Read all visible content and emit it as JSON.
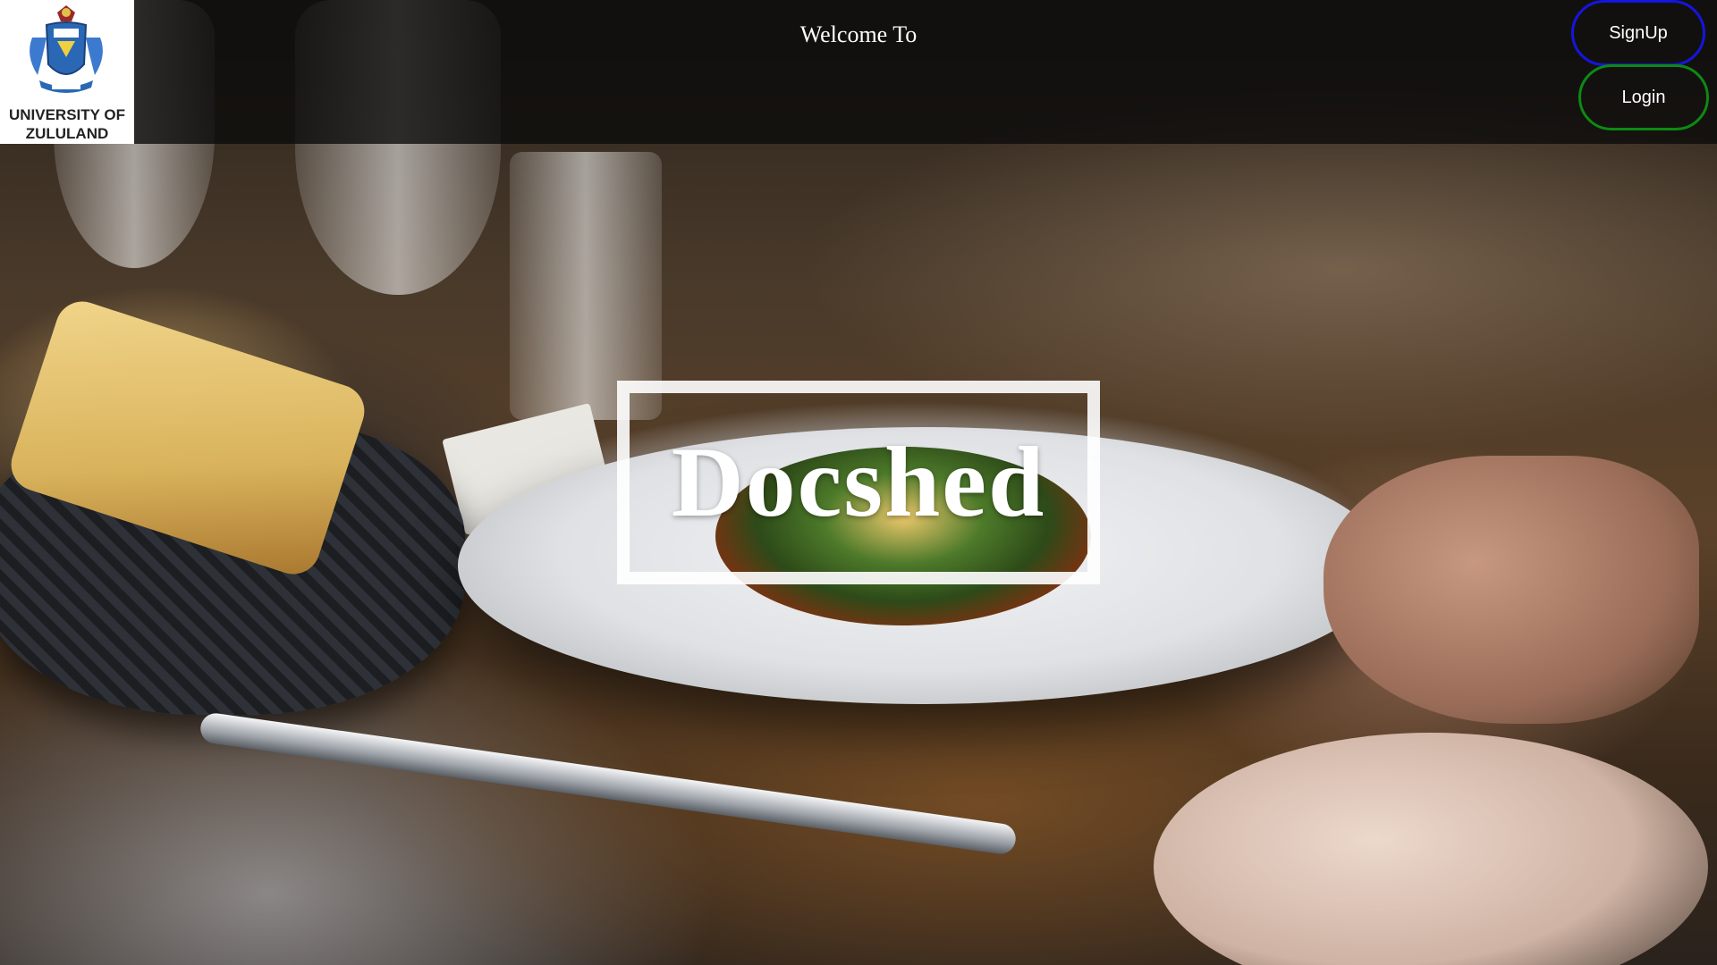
{
  "logo": {
    "text_line1": "UNIVERSITY OF",
    "text_line2": "ZULULAND"
  },
  "header": {
    "welcome": "Welcome To"
  },
  "nav": {
    "signup_label": "SignUp",
    "login_label": "Login",
    "signup_border_color": "#1515e0",
    "login_border_color": "#0c8a12"
  },
  "hero": {
    "title": "Docshed",
    "background": "restaurant table with plated dish"
  }
}
